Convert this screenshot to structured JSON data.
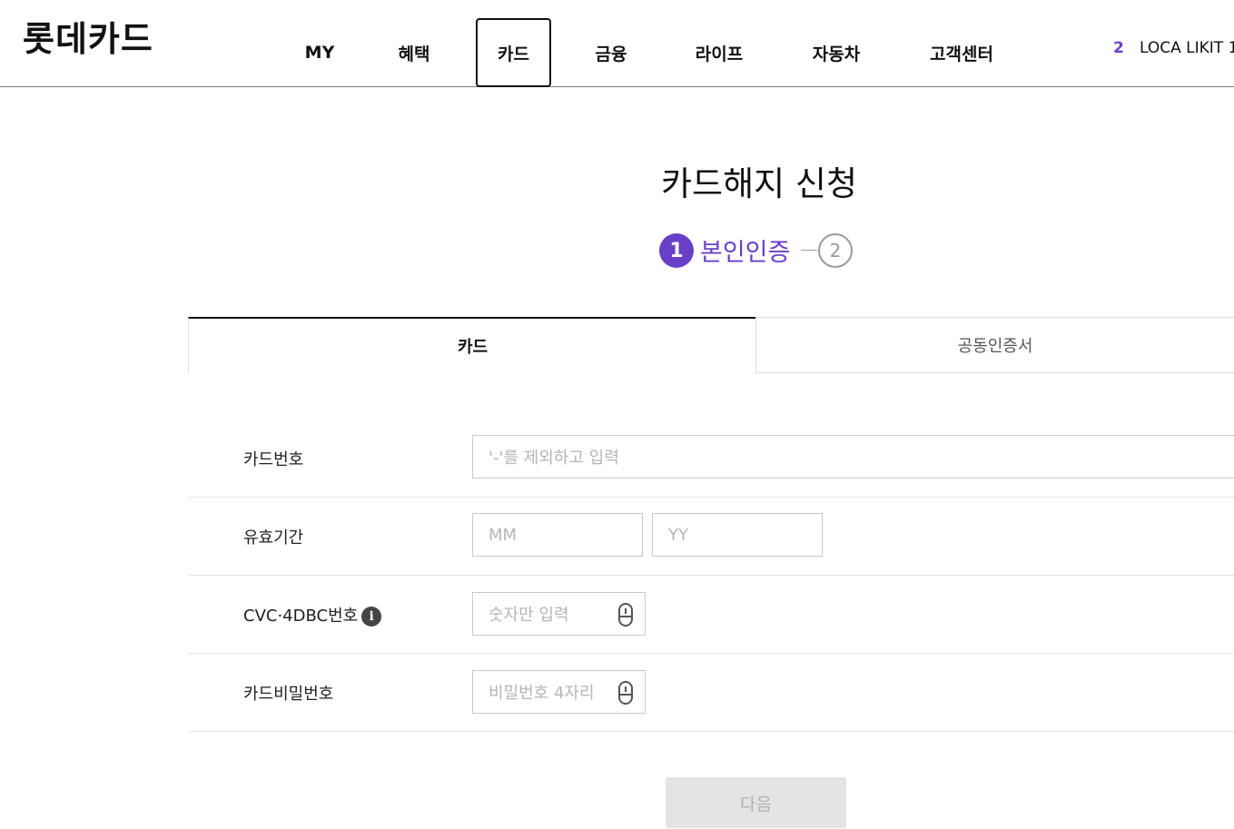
{
  "header": {
    "logo": "롯데카드",
    "nav": [
      "MY",
      "혜택",
      "카드",
      "금융",
      "라이프",
      "자동차",
      "고객센터"
    ],
    "active_nav": "카드",
    "notification_count": "2",
    "promo_text": "LOCA LIKIT 1."
  },
  "page": {
    "title": "카드해지 신청",
    "steps": [
      {
        "number": "1",
        "label": "본인인증",
        "active": true
      },
      {
        "number": "2",
        "active": false
      }
    ]
  },
  "tabs": [
    "카드",
    "공동인증서"
  ],
  "form": {
    "card_number": {
      "label": "카드번호",
      "placeholder": "'-'를 제외하고 입력"
    },
    "expiry": {
      "label": "유효기간",
      "month_placeholder": "MM",
      "year_placeholder": "YY"
    },
    "cvc": {
      "label": "CVC·4DBC번호",
      "info_icon": "i",
      "placeholder": "숫자만 입력"
    },
    "pin": {
      "label": "카드비밀번호",
      "placeholder": "비밀번호 4자리"
    }
  },
  "next_button": "다음",
  "colors": {
    "accent": "#6a3fc8",
    "disabled_button": "#e4e4e4"
  }
}
